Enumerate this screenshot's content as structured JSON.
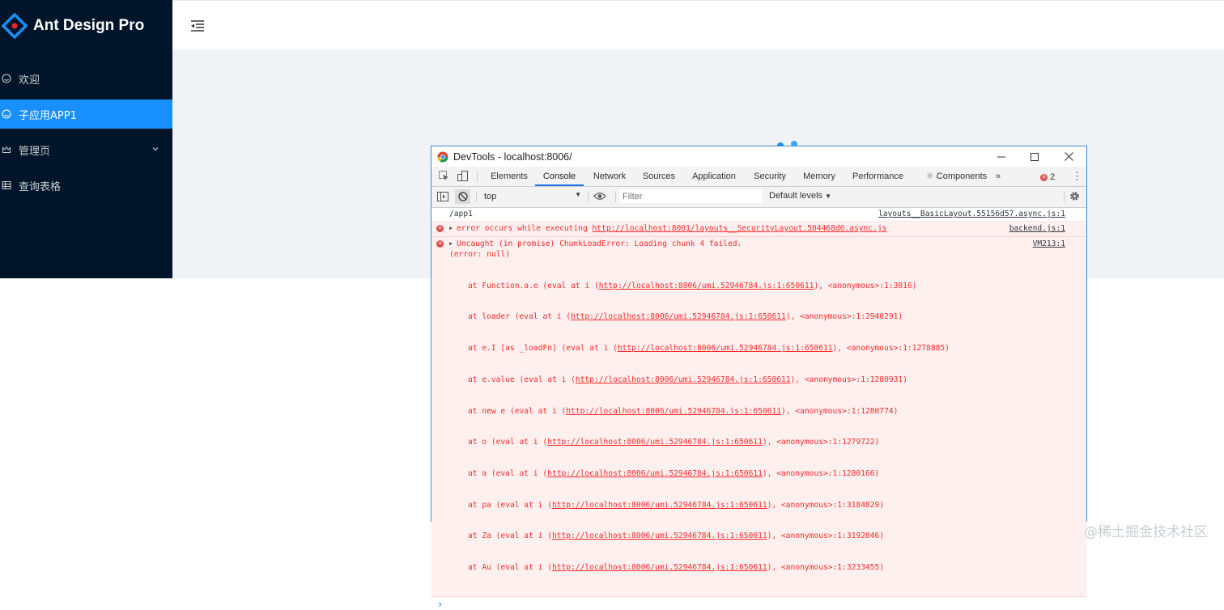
{
  "app": {
    "title": "Ant Design Pro",
    "brand_color": "#1890ff",
    "sider_color": "#001529"
  },
  "sidebar": {
    "items": [
      {
        "label": "欢迎",
        "icon": "smile-icon"
      },
      {
        "label": "子应用APP1",
        "icon": "smile-icon",
        "selected": true
      },
      {
        "label": "管理页",
        "icon": "crown-icon",
        "has_submenu": true
      },
      {
        "label": "查询表格",
        "icon": "table-icon"
      }
    ]
  },
  "devtools": {
    "title": "DevTools - localhost:8006/",
    "tabs": [
      "Elements",
      "Console",
      "Network",
      "Sources",
      "Application",
      "Security",
      "Memory",
      "Performance",
      "Components"
    ],
    "active_tab": "Console",
    "components_prefix": "⚛",
    "more_tabs": "»",
    "error_count": "2",
    "context": "top",
    "filter_placeholder": "Filter",
    "levels": "Default levels",
    "console": {
      "log1": {
        "text": "/app1",
        "source": "layouts__BasicLayout.55156d57.async.js:1"
      },
      "err1": {
        "text_prefix": "error occurs while executing ",
        "link": "http://localhost:8001/layouts__SecurityLayout.504468d6.async.js",
        "source": "backend.js:1"
      },
      "err2": {
        "header": "Uncaught (in promise) ChunkLoadError: Loading chunk 4 failed.",
        "subheader": "(error: null)",
        "source": "VM213:1",
        "stack": [
          {
            "pre": "at Function.a.e (eval at i (",
            "link": "http://localhost:8006/umi.52946784.js:1:650611",
            "post": "), <anonymous>:1:3016)"
          },
          {
            "pre": "at loader (eval at i (",
            "link": "http://localhost:8006/umi.52946784.js:1:650611",
            "post": "), <anonymous>:1:2940291)"
          },
          {
            "pre": "at e.I [as _loadFn] (eval at i (",
            "link": "http://localhost:8006/umi.52946784.js:1:650611",
            "post": "), <anonymous>:1:1278885)"
          },
          {
            "pre": "at e.value (eval at i (",
            "link": "http://localhost:8006/umi.52946784.js:1:650611",
            "post": "), <anonymous>:1:1280931)"
          },
          {
            "pre": "at new e (eval at i (",
            "link": "http://localhost:8006/umi.52946784.js:1:650611",
            "post": "), <anonymous>:1:1280774)"
          },
          {
            "pre": "at o (eval at i (",
            "link": "http://localhost:8006/umi.52946784.js:1:650611",
            "post": "), <anonymous>:1:1279722)"
          },
          {
            "pre": "at a (eval at i (",
            "link": "http://localhost:8006/umi.52946784.js:1:650611",
            "post": "), <anonymous>:1:1280166)"
          },
          {
            "pre": "at pa (eval at i (",
            "link": "http://localhost:8006/umi.52946784.js:1:650611",
            "post": "), <anonymous>:1:3184829)"
          },
          {
            "pre": "at Za (eval at i (",
            "link": "http://localhost:8006/umi.52946784.js:1:650611",
            "post": "), <anonymous>:1:3192846)"
          },
          {
            "pre": "at Au (eval at i (",
            "link": "http://localhost:8006/umi.52946784.js:1:650611",
            "post": "), <anonymous>:1:3233455)"
          }
        ]
      },
      "prompt": "›"
    }
  },
  "watermark": "@稀土掘金技术社区"
}
